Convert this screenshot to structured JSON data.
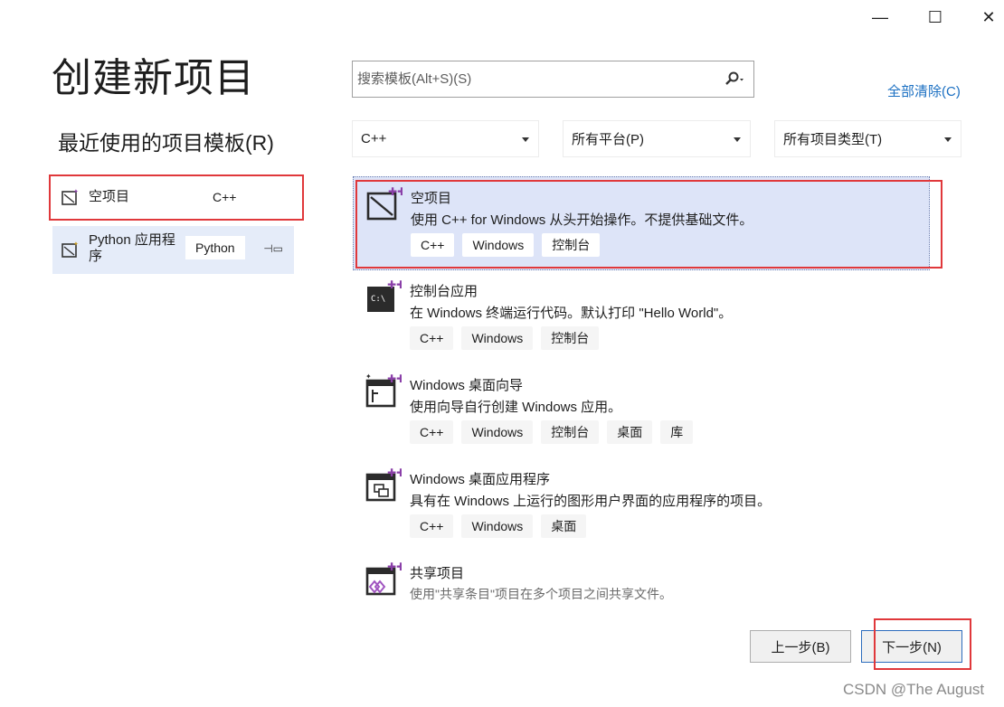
{
  "window": {
    "minimize": "—",
    "maximize": "☐",
    "close": "✕"
  },
  "title": "创建新项目",
  "recent": {
    "heading": "最近使用的项目模板(R)",
    "items": [
      {
        "name": "空项目",
        "tag": "C++",
        "icon": "empty-project-icon"
      },
      {
        "name": "Python 应用程序",
        "tag": "Python",
        "icon": "python-app-icon",
        "pinned": true
      }
    ]
  },
  "search": {
    "placeholder": "搜索模板(Alt+S)(S)",
    "icon": "search-icon"
  },
  "clear_all": "全部清除(C)",
  "filters": {
    "language": "C++",
    "platform": "所有平台(P)",
    "project_type": "所有项目类型(T)"
  },
  "templates": [
    {
      "name": "空项目",
      "description": "使用 C++ for Windows 从头开始操作。不提供基础文件。",
      "tags": [
        "C++",
        "Windows",
        "控制台"
      ],
      "icon": "empty-project-icon",
      "selected": true
    },
    {
      "name": "控制台应用",
      "description": "在 Windows 终端运行代码。默认打印 \"Hello World\"。",
      "tags": [
        "C++",
        "Windows",
        "控制台"
      ],
      "icon": "console-app-icon"
    },
    {
      "name": "Windows 桌面向导",
      "description": "使用向导自行创建 Windows 应用。",
      "tags": [
        "C++",
        "Windows",
        "控制台",
        "桌面",
        "库"
      ],
      "icon": "desktop-wizard-icon"
    },
    {
      "name": "Windows 桌面应用程序",
      "description": "具有在 Windows 上运行的图形用户界面的应用程序的项目。",
      "tags": [
        "C++",
        "Windows",
        "桌面"
      ],
      "icon": "desktop-app-icon"
    },
    {
      "name": "共享项目",
      "description": "使用\"共享条目\"项目在多个项目之间共享文件。",
      "tags": [],
      "icon": "shared-project-icon"
    }
  ],
  "buttons": {
    "back": "上一步(B)",
    "next": "下一步(N)"
  },
  "watermark": "CSDN @The    August",
  "colors": {
    "selected_bg": "#dde4f8",
    "highlight_red": "#e0383b",
    "link_blue": "#1a6fc2"
  }
}
